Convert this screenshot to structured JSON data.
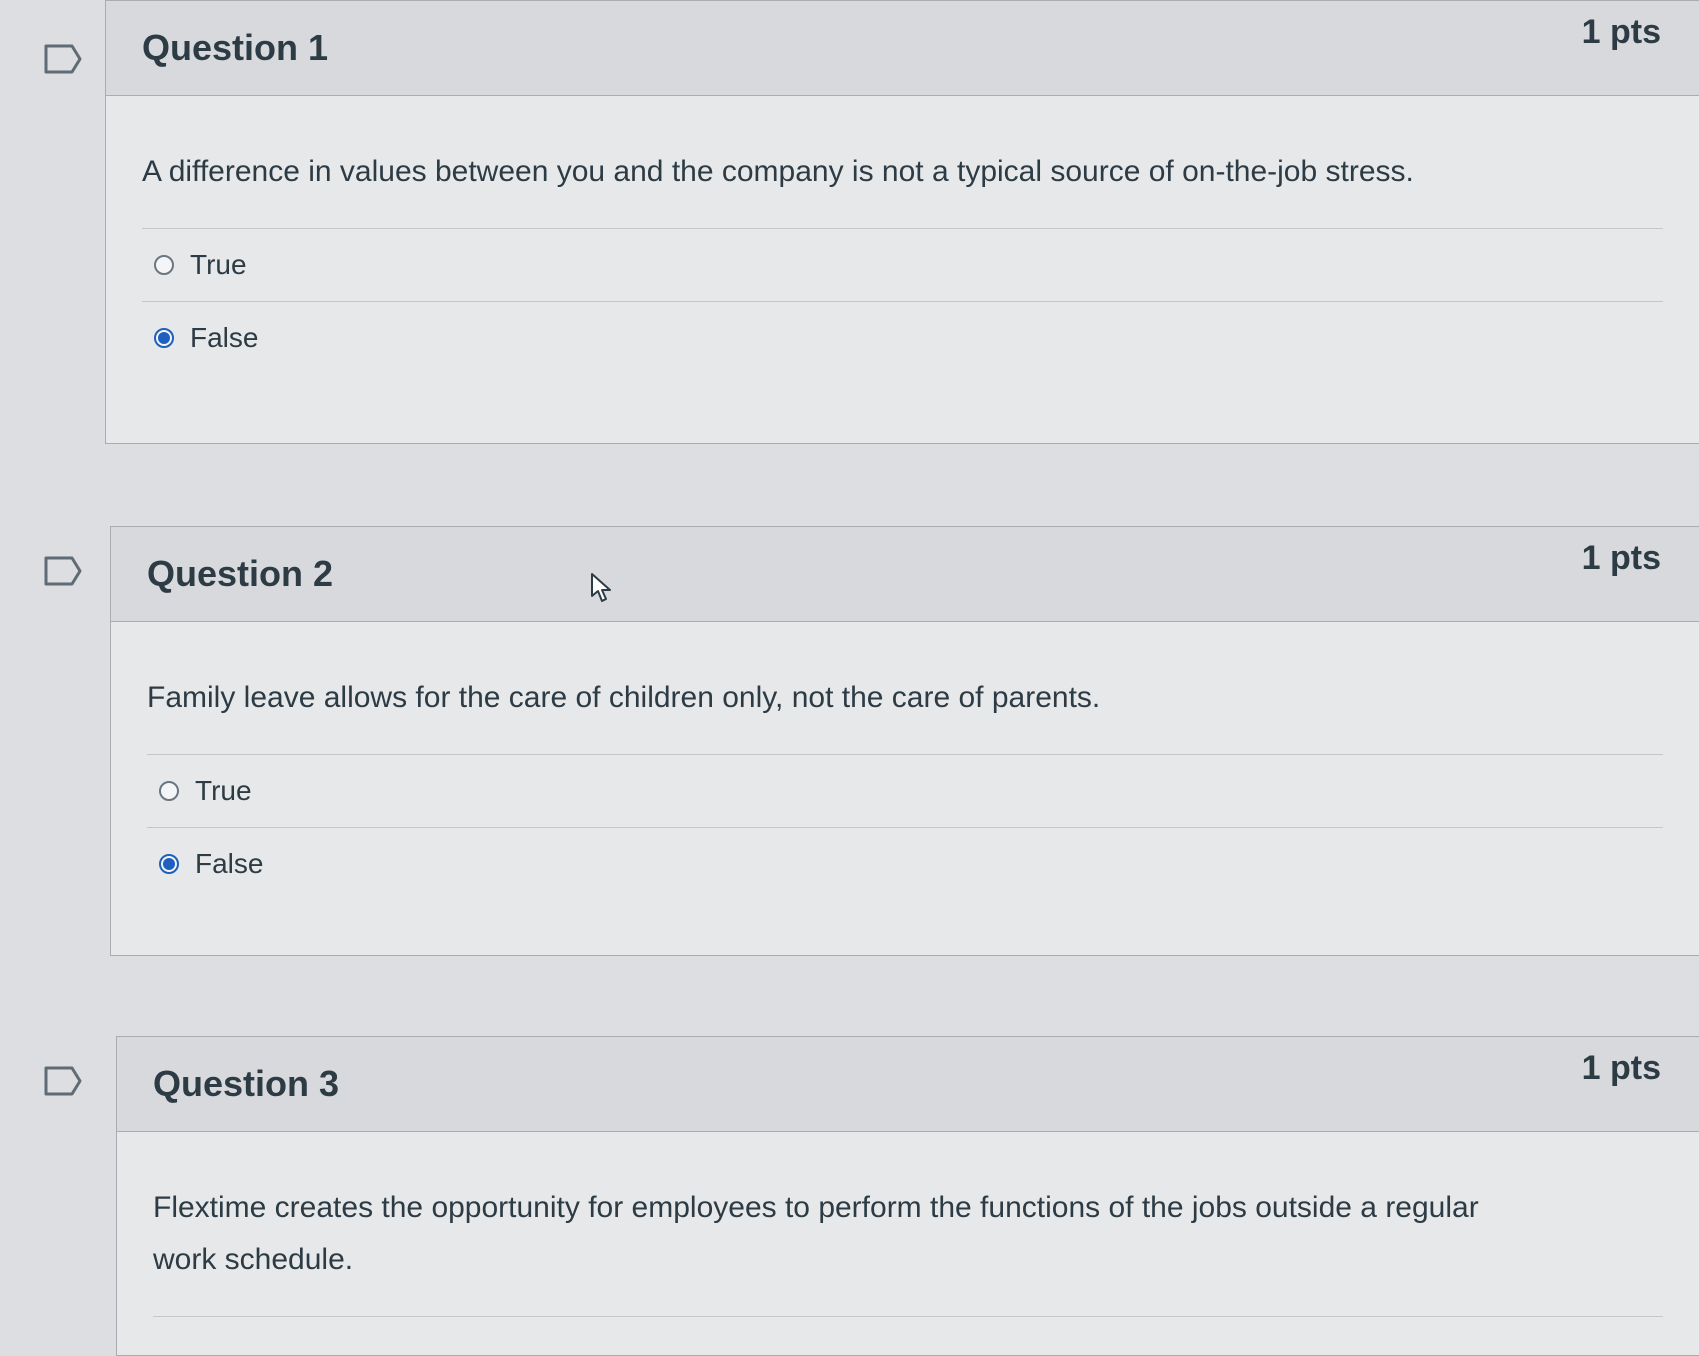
{
  "questions": [
    {
      "title": "Question 1",
      "points": "1 pts",
      "text": "A difference in values between you and the company is not a typical source of on-the-job stress.",
      "answers": [
        {
          "label": "True",
          "selected": false
        },
        {
          "label": "False",
          "selected": true
        }
      ]
    },
    {
      "title": "Question 2",
      "points": "1 pts",
      "text": "Family leave allows for the care of children only, not the care of parents.",
      "answers": [
        {
          "label": "True",
          "selected": false
        },
        {
          "label": "False",
          "selected": true
        }
      ]
    },
    {
      "title": "Question 3",
      "points": "1 pts",
      "text": "Flextime creates the opportunity for employees to perform the functions of the jobs outside a regular work schedule."
    }
  ],
  "colors": {
    "selected_radio": "#1f5fbf",
    "text": "#2d3b45",
    "header_bg": "#d7d9dc"
  },
  "icons": {
    "flag": "flag-bookmark-icon",
    "cursor": "mouse-pointer-icon"
  }
}
